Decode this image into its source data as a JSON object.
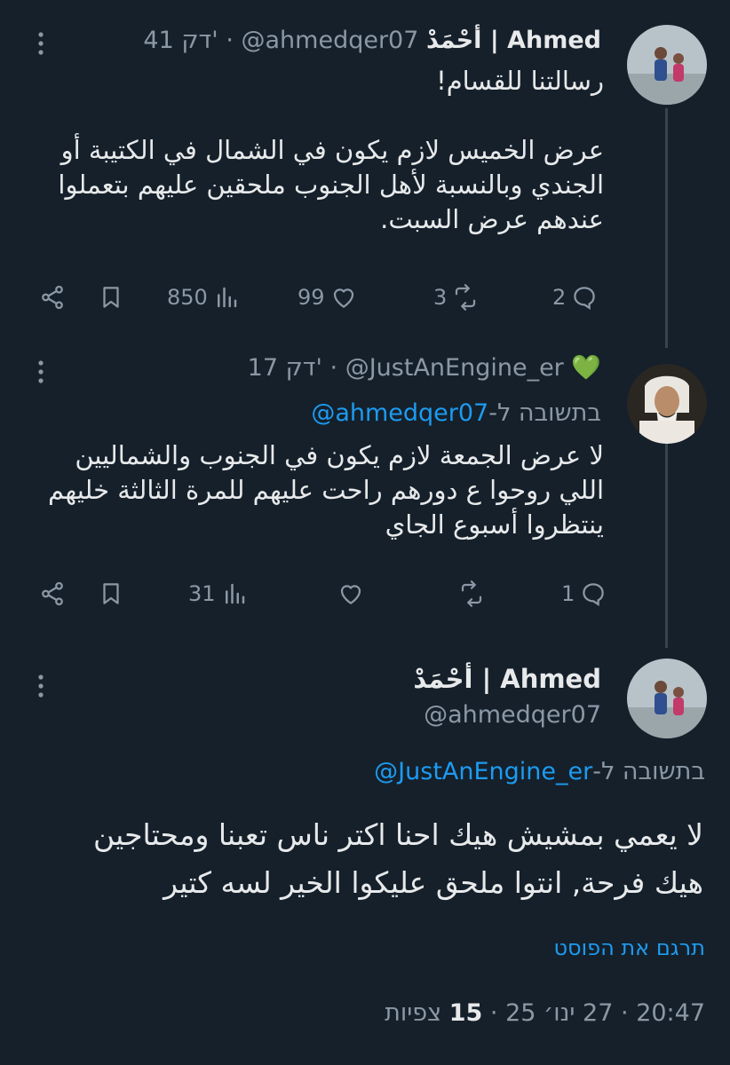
{
  "tweet1": {
    "display_name": "أحْمَدْ | Ahmed",
    "handle": "@ahmedqer07",
    "sep": "·",
    "time": "41 דק'",
    "text": "رسالتنا للقسام!\n\nعرض الخميس لازم يكون في الشمال في الكتيبة أو الجندي وبالنسبة لأهل الجنوب ملحقين عليهم بتعملوا عندهم عرض السبت.",
    "replies": "2",
    "retweets": "3",
    "likes": "99",
    "views": "850"
  },
  "tweet2": {
    "emoji": "💚",
    "handle": "@JustAnEngine_er",
    "sep": "·",
    "time": "17 דק'",
    "reply_prefix": "בתשובה ל-",
    "reply_handle": "@ahmedqer07",
    "text": "لا عرض الجمعة لازم يكون في الجنوب والشماليين اللي روحوا ع دورهم راحت عليهم للمرة الثالثة خليهم ينتظروا أسبوع الجاي",
    "replies": "1",
    "retweets": "",
    "likes": "",
    "views": "31"
  },
  "main_tweet": {
    "display_name": "أحْمَدْ | Ahmed",
    "handle": "@ahmedqer07",
    "reply_prefix": "בתשובה ל-",
    "reply_handle": "@JustAnEngine_er",
    "text": "لا يعمي بمشيش هيك احنا اكتر ناس تعبنا ومحتاجين هيك فرحة, انتوا ملحق عليكوا الخير لسه كتير",
    "translate_label": "תרגם את הפוסט",
    "time": "20:47",
    "date": "27 ינו׳ 25",
    "sep": "·",
    "views_count": "15",
    "views_label": "צפיות"
  },
  "icons": {
    "reply": "reply-icon",
    "retweet": "retweet-icon",
    "like": "heart-icon",
    "views": "views-icon",
    "bookmark": "bookmark-icon",
    "share": "share-icon",
    "more": "more-icon"
  },
  "colors": {
    "background": "#15202b",
    "text": "#e7e9ea",
    "secondary": "#8b98a5",
    "link": "#1d9bf0",
    "divider": "#38444d"
  }
}
